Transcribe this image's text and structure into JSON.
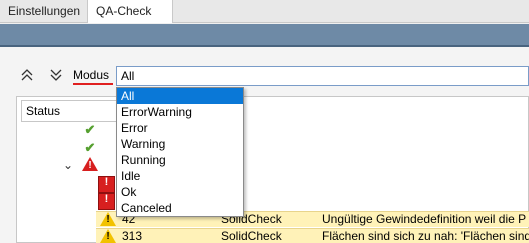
{
  "tabs": [
    {
      "label": "Einstellungen",
      "active": false
    },
    {
      "label": "QA-Check",
      "active": true
    }
  ],
  "toolbar": {
    "up_icon": "double-chevron-up-icon",
    "down_icon": "double-chevron-down-icon",
    "modus_label": "Modus",
    "modus_value": "All"
  },
  "dropdown": {
    "options": [
      "All",
      "ErrorWarning",
      "Error",
      "Warning",
      "Running",
      "Idle",
      "Ok",
      "Canceled"
    ],
    "selected": "All"
  },
  "grid": {
    "status_header": "Status",
    "rows": [
      {
        "num": "42",
        "type": "SolidCheck",
        "message": "Ungültige Gewindedefinition weil die P"
      },
      {
        "num": "313",
        "type": "SolidCheck",
        "message": "Flächen sind sich zu nah: 'Flächen sind"
      }
    ]
  },
  "colors": {
    "accent": "#0a78d7",
    "ribbon": "#6e8aa6",
    "warning_row": "#fff2b8",
    "error": "#d71f1f",
    "ok": "#56a030",
    "modus_underline": "#e02020"
  }
}
